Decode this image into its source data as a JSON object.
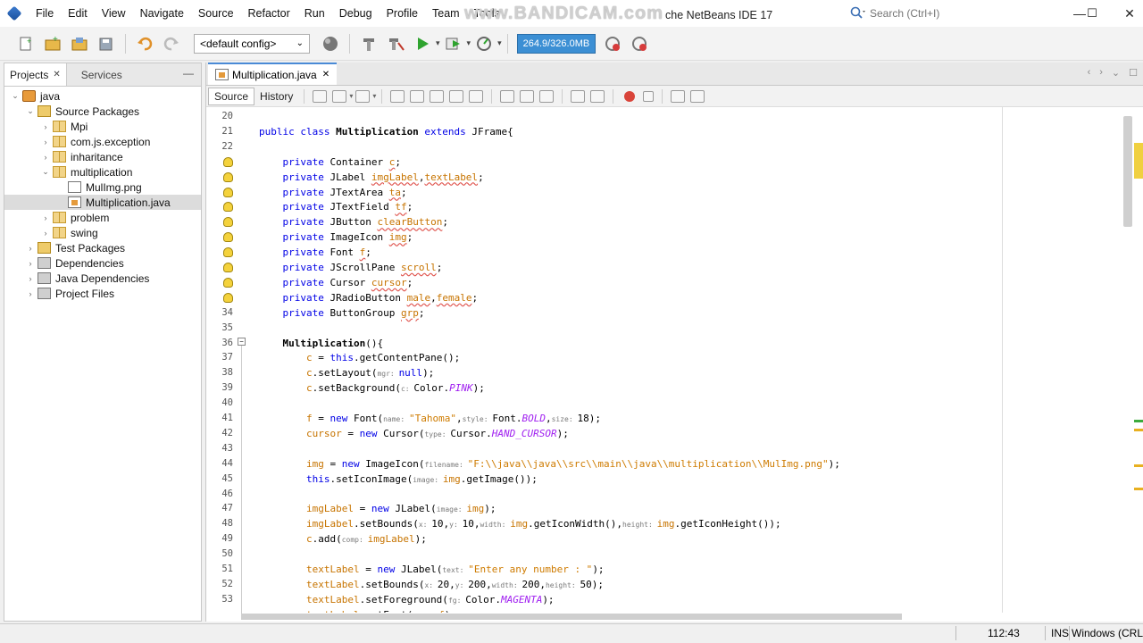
{
  "window": {
    "title_watermark": "www.BANDICAM.com",
    "title_suffix": "che NetBeans IDE 17",
    "controls": {
      "minimize": "—",
      "maximize": "☐",
      "close": "✕"
    }
  },
  "menubar": {
    "items": [
      "File",
      "Edit",
      "View",
      "Navigate",
      "Source",
      "Refactor",
      "Run",
      "Debug",
      "Profile",
      "Team",
      "Tools"
    ]
  },
  "search": {
    "placeholder": "Search (Ctrl+I)"
  },
  "toolbar": {
    "config": "<default config>",
    "memory": "264.9/326.0MB"
  },
  "projects_panel": {
    "tabs": [
      {
        "label": "Projects",
        "active": true
      },
      {
        "label": "Services",
        "active": false
      }
    ],
    "tree": [
      {
        "label": "java",
        "level": 0,
        "twisty": "⌄",
        "icon": "proj"
      },
      {
        "label": "Source Packages",
        "level": 1,
        "twisty": "⌄",
        "icon": "folder"
      },
      {
        "label": "Mpi",
        "level": 2,
        "twisty": "›",
        "icon": "pkg"
      },
      {
        "label": "com.js.exception",
        "level": 2,
        "twisty": "›",
        "icon": "pkg"
      },
      {
        "label": "inharitance",
        "level": 2,
        "twisty": "›",
        "icon": "pkg"
      },
      {
        "label": "multiplication",
        "level": 2,
        "twisty": "⌄",
        "icon": "pkg"
      },
      {
        "label": "MulImg.png",
        "level": 3,
        "twisty": "",
        "icon": "file"
      },
      {
        "label": "Multiplication.java",
        "level": 3,
        "twisty": "",
        "icon": "java",
        "selected": true
      },
      {
        "label": "problem",
        "level": 2,
        "twisty": "›",
        "icon": "pkg"
      },
      {
        "label": "swing",
        "level": 2,
        "twisty": "›",
        "icon": "pkg"
      },
      {
        "label": "Test Packages",
        "level": 1,
        "twisty": "›",
        "icon": "folder"
      },
      {
        "label": "Dependencies",
        "level": 1,
        "twisty": "›",
        "icon": "lib"
      },
      {
        "label": "Java Dependencies",
        "level": 1,
        "twisty": "›",
        "icon": "lib"
      },
      {
        "label": "Project Files",
        "level": 1,
        "twisty": "›",
        "icon": "lib"
      }
    ]
  },
  "editor": {
    "tab": {
      "label": "Multiplication.java"
    },
    "toolbar": {
      "source": "Source",
      "history": "History"
    },
    "line_numbers": [
      "20",
      "21",
      "22",
      "",
      "",
      "",
      "",
      "",
      "",
      "",
      "",
      "",
      "",
      "34",
      "35",
      "36",
      "37",
      "38",
      "39",
      "40",
      "41",
      "42",
      "43",
      "44",
      "45",
      "46",
      "47",
      "48",
      "49",
      "50",
      "51",
      "52",
      "53"
    ],
    "code_lines": [
      [],
      [
        [
          "k",
          "public class "
        ],
        [
          "b",
          "Multiplication"
        ],
        [
          "k",
          " extends "
        ],
        [
          "p",
          "JFrame{"
        ]
      ],
      [],
      [
        [
          "p",
          "    "
        ],
        [
          "k",
          "private "
        ],
        [
          "p",
          "Container "
        ],
        [
          "w",
          "c"
        ],
        [
          "p",
          ";"
        ]
      ],
      [
        [
          "p",
          "    "
        ],
        [
          "k",
          "private "
        ],
        [
          "p",
          "JLabel "
        ],
        [
          "w",
          "imgLabel"
        ],
        [
          "p",
          ","
        ],
        [
          "w",
          "textLabel"
        ],
        [
          "p",
          ";"
        ]
      ],
      [
        [
          "p",
          "    "
        ],
        [
          "k",
          "private "
        ],
        [
          "p",
          "JTextArea "
        ],
        [
          "w",
          "ta"
        ],
        [
          "p",
          ";"
        ]
      ],
      [
        [
          "p",
          "    "
        ],
        [
          "k",
          "private "
        ],
        [
          "p",
          "JTextField "
        ],
        [
          "w",
          "tf"
        ],
        [
          "p",
          ";"
        ]
      ],
      [
        [
          "p",
          "    "
        ],
        [
          "k",
          "private "
        ],
        [
          "p",
          "JButton "
        ],
        [
          "w",
          "clearButton"
        ],
        [
          "p",
          ";"
        ]
      ],
      [
        [
          "p",
          "    "
        ],
        [
          "k",
          "private "
        ],
        [
          "p",
          "ImageIcon "
        ],
        [
          "w",
          "img"
        ],
        [
          "p",
          ";"
        ]
      ],
      [
        [
          "p",
          "    "
        ],
        [
          "k",
          "private "
        ],
        [
          "p",
          "Font "
        ],
        [
          "w",
          "f"
        ],
        [
          "p",
          ";"
        ]
      ],
      [
        [
          "p",
          "    "
        ],
        [
          "k",
          "private "
        ],
        [
          "p",
          "JScrollPane "
        ],
        [
          "w",
          "scroll"
        ],
        [
          "p",
          ";"
        ]
      ],
      [
        [
          "p",
          "    "
        ],
        [
          "k",
          "private "
        ],
        [
          "p",
          "Cursor "
        ],
        [
          "w",
          "cursor"
        ],
        [
          "p",
          ";"
        ]
      ],
      [
        [
          "p",
          "    "
        ],
        [
          "k",
          "private "
        ],
        [
          "p",
          "JRadioButton "
        ],
        [
          "w",
          "male"
        ],
        [
          "p",
          ","
        ],
        [
          "w",
          "female"
        ],
        [
          "p",
          ";"
        ]
      ],
      [
        [
          "p",
          "    "
        ],
        [
          "k",
          "private "
        ],
        [
          "p",
          "ButtonGroup "
        ],
        [
          "w",
          "grp"
        ],
        [
          "p",
          ";"
        ]
      ],
      [],
      [
        [
          "p",
          "    "
        ],
        [
          "b",
          "Multiplication"
        ],
        [
          "p",
          "(){"
        ]
      ],
      [
        [
          "p",
          "        "
        ],
        [
          "fld",
          "c"
        ],
        [
          "p",
          " = "
        ],
        [
          "k",
          "this"
        ],
        [
          "p",
          ".getContentPane();"
        ]
      ],
      [
        [
          "p",
          "        "
        ],
        [
          "fld",
          "c"
        ],
        [
          "p",
          ".setLayout("
        ],
        [
          "i",
          "mgr: "
        ],
        [
          "k",
          "null"
        ],
        [
          "p",
          ");"
        ]
      ],
      [
        [
          "p",
          "        "
        ],
        [
          "fld",
          "c"
        ],
        [
          "p",
          ".setBackground("
        ],
        [
          "i",
          "c: "
        ],
        [
          "p",
          "Color."
        ],
        [
          "f",
          "PINK"
        ],
        [
          "p",
          ");"
        ]
      ],
      [],
      [
        [
          "p",
          "        "
        ],
        [
          "fld",
          "f"
        ],
        [
          "p",
          " = "
        ],
        [
          "k",
          "new "
        ],
        [
          "p",
          "Font("
        ],
        [
          "i",
          "name: "
        ],
        [
          "s",
          "\"Tahoma\""
        ],
        [
          "p",
          ","
        ],
        [
          "i",
          "style: "
        ],
        [
          "p",
          "Font."
        ],
        [
          "f",
          "BOLD"
        ],
        [
          "p",
          ","
        ],
        [
          "i",
          "size: "
        ],
        [
          "p",
          "18);"
        ]
      ],
      [
        [
          "p",
          "        "
        ],
        [
          "fld",
          "cursor"
        ],
        [
          "p",
          " = "
        ],
        [
          "k",
          "new "
        ],
        [
          "p",
          "Cursor("
        ],
        [
          "i",
          "type: "
        ],
        [
          "p",
          "Cursor."
        ],
        [
          "f",
          "HAND_CURSOR"
        ],
        [
          "p",
          ");"
        ]
      ],
      [],
      [
        [
          "p",
          "        "
        ],
        [
          "fld",
          "img"
        ],
        [
          "p",
          " = "
        ],
        [
          "k",
          "new "
        ],
        [
          "p",
          "ImageIcon("
        ],
        [
          "i",
          "filename: "
        ],
        [
          "s",
          "\"F:\\\\java\\\\java\\\\src\\\\main\\\\java\\\\multiplication\\\\MulImg.png\""
        ],
        [
          "p",
          ");"
        ]
      ],
      [
        [
          "p",
          "        "
        ],
        [
          "k",
          "this"
        ],
        [
          "p",
          ".setIconImage("
        ],
        [
          "i",
          "image: "
        ],
        [
          "fld",
          "img"
        ],
        [
          "p",
          ".getImage());"
        ]
      ],
      [],
      [
        [
          "p",
          "        "
        ],
        [
          "fld",
          "imgLabel"
        ],
        [
          "p",
          " = "
        ],
        [
          "k",
          "new "
        ],
        [
          "p",
          "JLabel("
        ],
        [
          "i",
          "image: "
        ],
        [
          "fld",
          "img"
        ],
        [
          "p",
          ");"
        ]
      ],
      [
        [
          "p",
          "        "
        ],
        [
          "fld",
          "imgLabel"
        ],
        [
          "p",
          ".setBounds("
        ],
        [
          "i",
          "x: "
        ],
        [
          "p",
          "10,"
        ],
        [
          "i",
          "y: "
        ],
        [
          "p",
          "10,"
        ],
        [
          "i",
          "width: "
        ],
        [
          "fld",
          "img"
        ],
        [
          "p",
          ".getIconWidth(),"
        ],
        [
          "i",
          "height: "
        ],
        [
          "fld",
          "img"
        ],
        [
          "p",
          ".getIconHeight());"
        ]
      ],
      [
        [
          "p",
          "        "
        ],
        [
          "fld",
          "c"
        ],
        [
          "p",
          ".add("
        ],
        [
          "i",
          "comp: "
        ],
        [
          "fld",
          "imgLabel"
        ],
        [
          "p",
          ");"
        ]
      ],
      [],
      [
        [
          "p",
          "        "
        ],
        [
          "fld",
          "textLabel"
        ],
        [
          "p",
          " = "
        ],
        [
          "k",
          "new "
        ],
        [
          "p",
          "JLabel("
        ],
        [
          "i",
          "text: "
        ],
        [
          "s",
          "\"Enter any number : \""
        ],
        [
          "p",
          ");"
        ]
      ],
      [
        [
          "p",
          "        "
        ],
        [
          "fld",
          "textLabel"
        ],
        [
          "p",
          ".setBounds("
        ],
        [
          "i",
          "x: "
        ],
        [
          "p",
          "20,"
        ],
        [
          "i",
          "y: "
        ],
        [
          "p",
          "200,"
        ],
        [
          "i",
          "width: "
        ],
        [
          "p",
          "200,"
        ],
        [
          "i",
          "height: "
        ],
        [
          "p",
          "50);"
        ]
      ],
      [
        [
          "p",
          "        "
        ],
        [
          "fld",
          "textLabel"
        ],
        [
          "p",
          ".setForeground("
        ],
        [
          "i",
          "fg: "
        ],
        [
          "p",
          "Color."
        ],
        [
          "f",
          "MAGENTA"
        ],
        [
          "p",
          ");"
        ]
      ],
      [
        [
          "p",
          "        "
        ],
        [
          "fld",
          "textLabel"
        ],
        [
          "p",
          ".setFont("
        ],
        [
          "i",
          "font: "
        ],
        [
          "fld",
          "f"
        ],
        [
          "p",
          ");"
        ]
      ]
    ]
  },
  "statusbar": {
    "position": "112:43",
    "mode": "INS",
    "line_endings": "Windows (CRLF)"
  }
}
